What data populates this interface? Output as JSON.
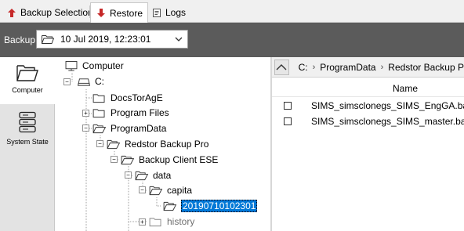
{
  "tabs": [
    {
      "label": "Backup Selection",
      "icon": "up-arrow-icon",
      "active": false
    },
    {
      "label": "Restore",
      "icon": "down-arrow-icon",
      "active": true
    },
    {
      "label": "Logs",
      "icon": "log-icon",
      "active": false
    }
  ],
  "backup": {
    "label": "Backup:",
    "selected": "10 Jul 2019, 12:23:01"
  },
  "categories": [
    {
      "label": "Computer",
      "icon": "folder-open-icon",
      "active": true
    },
    {
      "label": "System State",
      "icon": "server-stack-icon",
      "active": false
    }
  ],
  "tree": {
    "root": "Computer",
    "nodes": [
      {
        "label": "C:",
        "icon": "drive-icon"
      },
      {
        "label": "DocsTorAgE",
        "icon": "folder-icon"
      },
      {
        "label": "Program Files",
        "icon": "folder-icon"
      },
      {
        "label": "ProgramData",
        "icon": "folder-open-icon"
      },
      {
        "label": "Redstor Backup Pro",
        "icon": "folder-open-icon"
      },
      {
        "label": "Backup Client ESE",
        "icon": "folder-open-icon"
      },
      {
        "label": "data",
        "icon": "folder-open-icon"
      },
      {
        "label": "capita",
        "icon": "folder-open-icon"
      },
      {
        "label": "20190710102301",
        "icon": "folder-open-icon",
        "selected": true
      },
      {
        "label": "history",
        "icon": "folder-icon",
        "dim": true
      }
    ]
  },
  "list": {
    "breadcrumb": [
      "C:",
      "ProgramData",
      "Redstor Backup P"
    ],
    "column_name": "Name",
    "files": [
      {
        "name": "SIMS_simsclonegs_SIMS_EngGA.bak",
        "checked": false
      },
      {
        "name": "SIMS_simsclonegs_SIMS_master.bak",
        "checked": false
      }
    ]
  },
  "colors": {
    "accent": "#0078d7",
    "restore_arrow": "#c62828",
    "toolbar_bg": "#5b5b5b",
    "tab_bg": "#f0f0f0"
  }
}
